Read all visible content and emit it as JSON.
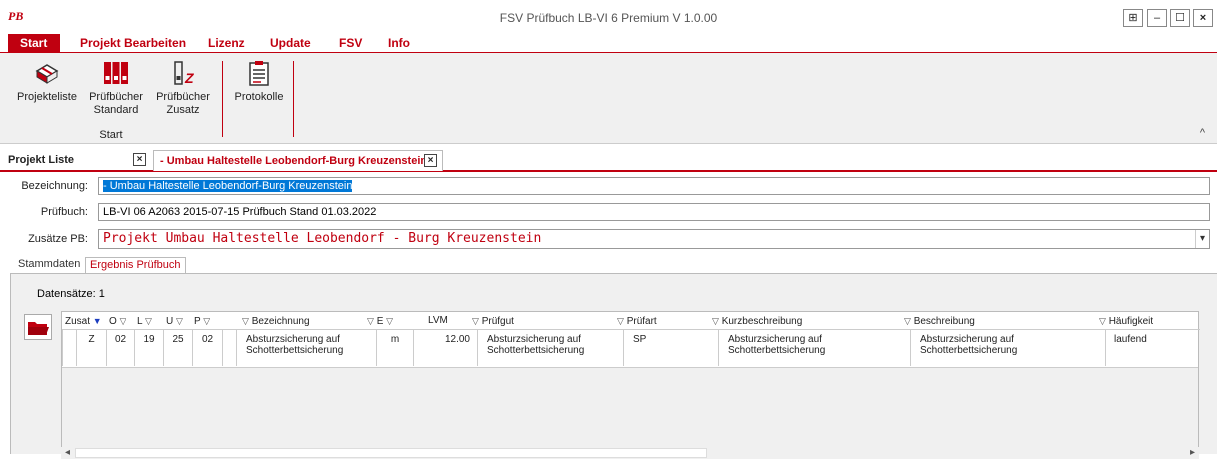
{
  "window": {
    "logo": "PB",
    "title": "FSV Prüfbuch LB-VI 6 Premium V 1.0.00",
    "btn_pin": "⊞",
    "btn_min": "–",
    "btn_max": "☐",
    "btn_close": "×"
  },
  "menu": {
    "start": "Start",
    "projekt": "Projekt Bearbeiten",
    "lizenz": "Lizenz",
    "update": "Update",
    "fsv": "FSV",
    "info": "Info"
  },
  "ribbon": {
    "projekteliste": "Projekteliste",
    "pb_standard_1": "Prüfbücher",
    "pb_standard_2": "Standard",
    "pb_zusatz_1": "Prüfbücher",
    "pb_zusatz_2": "Zusatz",
    "protokolle": "Protokolle",
    "group": "Start",
    "collapse": "^",
    "accent": "#c00010"
  },
  "doctabs": {
    "projekt_liste": "Projekt Liste",
    "close": "×",
    "active_title": "- Umbau Haltestelle Leobendorf-Burg Kreuzenstein"
  },
  "form": {
    "bezeichnung_label": "Bezeichnung:",
    "bezeichnung_value": "- Umbau Haltestelle Leobendorf-Burg Kreuzenstein",
    "pruefbuch_label": "Prüfbuch:",
    "pruefbuch_value": "LB-VI 06 A2063 2015-07-15 Prüfbuch Stand 01.03.2022",
    "zusaetze_label": "Zusätze PB:",
    "zusaetze_value": "Projekt Umbau Haltestelle Leobendorf - Burg Kreuzenstein",
    "dropdown": "▾"
  },
  "subtabs": {
    "stammdaten": "Stammdaten",
    "ergebnis": "Ergebnis Prüfbuch"
  },
  "panel": {
    "record_count": "Datensätze: 1"
  },
  "grid": {
    "filter": "▽",
    "filter_on": "▼",
    "headers": {
      "zusat": "Zusat",
      "o": "O",
      "l": "L",
      "u": "U",
      "p": "P",
      "bezeichnung": "Bezeichnung",
      "e": "E",
      "lvm": "LVM",
      "pruefgut": "Prüfgut",
      "pruefart": "Prüfart",
      "kurz": "Kurzbeschreibung",
      "beschreibung": "Beschreibung",
      "haeufigkeit": "Häufigkeit"
    },
    "row": {
      "zusat": "Z",
      "o": "02",
      "l": "19",
      "u": "25",
      "p": "02",
      "bez1": "Absturzsicherung auf",
      "bez2": "Schotterbettsicherung",
      "e": "m",
      "lvm": "12.00",
      "pg1": "Absturzsicherung auf",
      "pg2": "Schotterbettsicherung",
      "pruefart": "SP",
      "kb1": "Absturzsicherung auf",
      "kb2": "Schotterbettsicherung",
      "be1": "Absturzsicherung auf",
      "be2": "Schotterbettsicherung",
      "haeufigkeit": "laufend"
    },
    "scroll_left": "◂",
    "scroll_right": "▸"
  }
}
